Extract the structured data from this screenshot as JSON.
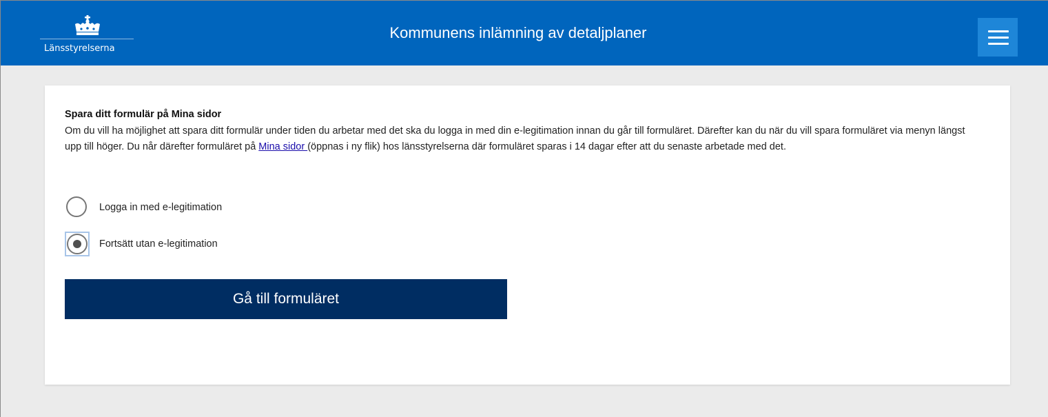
{
  "header": {
    "logo_text": "Länsstyrelserna",
    "title": "Kommunens inlämning av detaljplaner",
    "menu_icon": "hamburger-menu-icon",
    "logo_icon": "crown-icon"
  },
  "card": {
    "heading": "Spara ditt formulär på Mina sidor",
    "intro_before_link": "Om du vill ha möjlighet att spara ditt formulär under tiden du arbetar med det ska du logga in med din e-legitimation innan du går till formuläret. Därefter kan du när du vill spara formuläret via menyn längst upp till höger. Du når därefter formuläret på ",
    "link_text": "Mina sidor ",
    "intro_after_link": "(öppnas i ny flik) hos länsstyrelserna där formuläret sparas i 14 dagar efter att du senaste arbetade med det.",
    "options": [
      {
        "label": "Logga in med e-legitimation",
        "selected": false
      },
      {
        "label": "Fortsätt utan e-legitimation",
        "selected": true
      }
    ],
    "submit_label": "Gå till formuläret"
  },
  "colors": {
    "header_bg": "#0065bd",
    "menu_button_bg": "#1e86d8",
    "primary_button_bg": "#002d62",
    "page_bg": "#ebebeb",
    "link": "#1a0dab"
  }
}
